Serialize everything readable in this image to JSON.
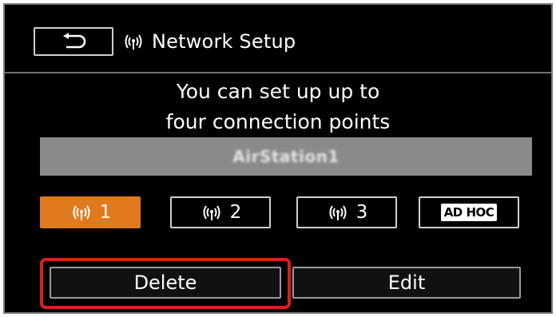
{
  "header": {
    "back_icon": "return-arrow-icon",
    "wifi_icon": "wifi-antenna-icon",
    "title": "Network Setup"
  },
  "message": {
    "line1": "You can set up up to",
    "line2": "four connection points"
  },
  "ssid": {
    "name": "AirStation1"
  },
  "connection_points": [
    {
      "label": "1",
      "icon": "wifi-antenna-icon",
      "selected": true
    },
    {
      "label": "2",
      "icon": "wifi-antenna-icon",
      "selected": false
    },
    {
      "label": "3",
      "icon": "wifi-antenna-icon",
      "selected": false
    },
    {
      "label": "AD HOC",
      "icon": null,
      "selected": false
    }
  ],
  "actions": {
    "delete_label": "Delete",
    "edit_label": "Edit"
  },
  "colors": {
    "background": "#000000",
    "selected": "#e07a1f",
    "highlight": "#d8201e",
    "ssid_bar": "#8a8a8a"
  }
}
